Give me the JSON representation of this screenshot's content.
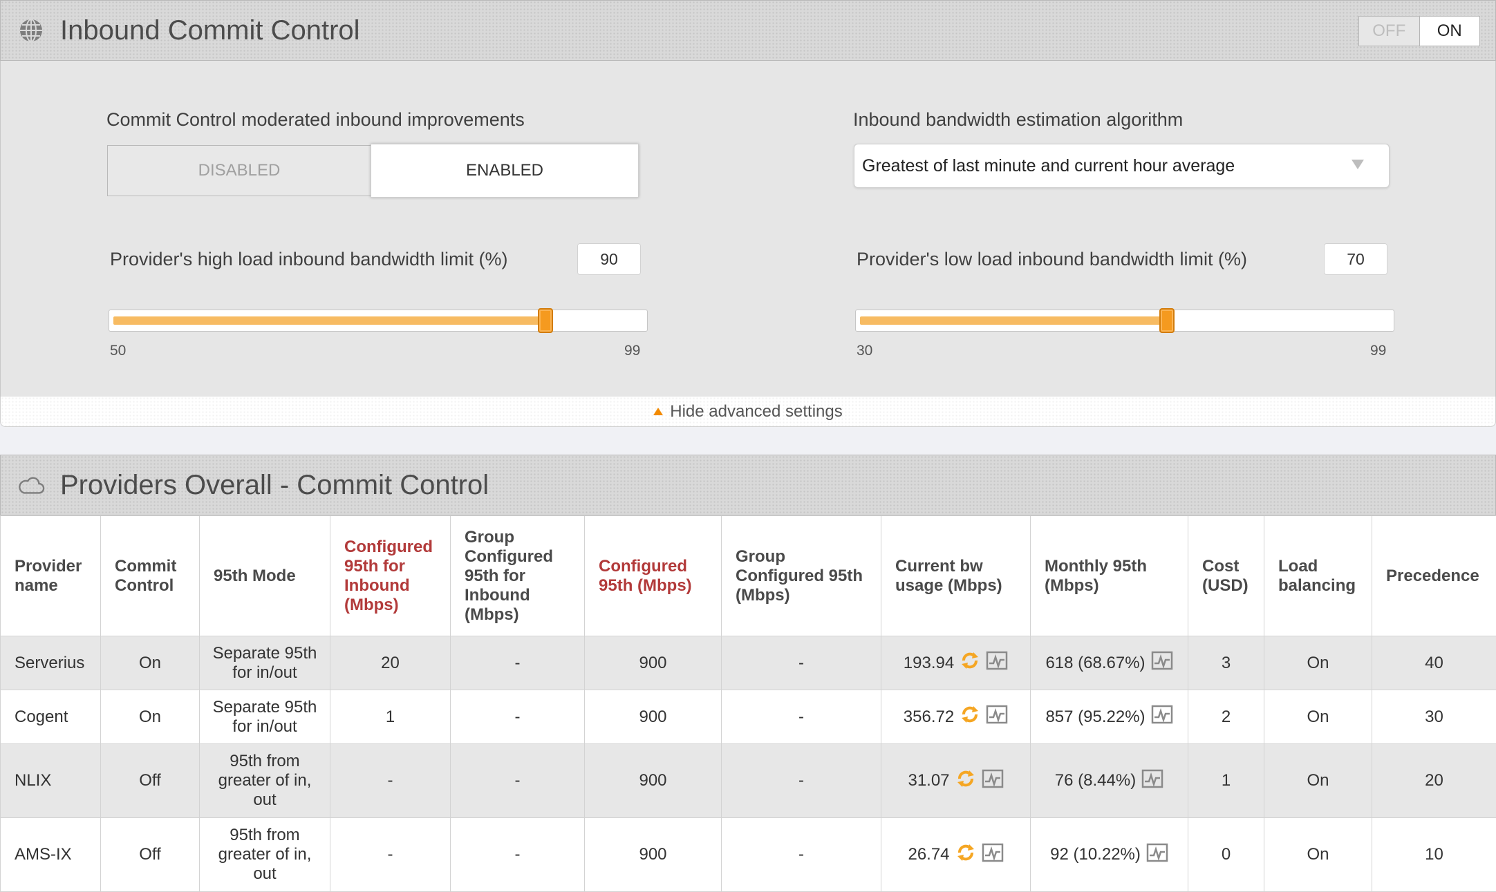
{
  "inbound": {
    "title": "Inbound Commit Control",
    "toggle": {
      "off_label": "OFF",
      "on_label": "ON",
      "state": "ON"
    },
    "moderated_label": "Commit Control moderated inbound improvements",
    "moderated": {
      "disabled_label": "DISABLED",
      "enabled_label": "ENABLED",
      "state": "ENABLED"
    },
    "algorithm_label": "Inbound bandwidth estimation algorithm",
    "algorithm_value": "Greatest of last minute and current hour average",
    "high_limit": {
      "label": "Provider's high load inbound bandwidth limit (%)",
      "value": "90",
      "min": "50",
      "max": "99",
      "level": 90
    },
    "low_limit": {
      "label": "Provider's low load inbound bandwidth limit (%)",
      "value": "70",
      "min": "30",
      "max": "99",
      "level": 70
    },
    "hide_advanced_label": "Hide advanced settings"
  },
  "providers": {
    "title": "Providers Overall - Commit Control",
    "columns": [
      "Provider name",
      "Commit Control",
      "95th Mode",
      "Configured 95th for Inbound (Mbps)",
      "Group Configured 95th for Inbound (Mbps)",
      "Configured 95th (Mbps)",
      "Group Configured 95th (Mbps)",
      "Current bw usage (Mbps)",
      "Monthly 95th (Mbps)",
      "Cost (USD)",
      "Load balancing",
      "Precedence"
    ],
    "rows": [
      {
        "name": "Serverius",
        "commit": "On",
        "mode": "Separate 95th for in/out",
        "cfg_in": "20",
        "grp_in": "-",
        "cfg": "900",
        "grp": "-",
        "current": "193.94",
        "monthly": "618 (68.67%)",
        "cost": "3",
        "lb": "On",
        "prec": "40"
      },
      {
        "name": "Cogent",
        "commit": "On",
        "mode": "Separate 95th for in/out",
        "cfg_in": "1",
        "grp_in": "-",
        "cfg": "900",
        "grp": "-",
        "current": "356.72",
        "monthly": "857 (95.22%)",
        "cost": "2",
        "lb": "On",
        "prec": "30"
      },
      {
        "name": "NLIX",
        "commit": "Off",
        "mode": "95th from greater of in, out",
        "cfg_in": "-",
        "grp_in": "-",
        "cfg": "900",
        "grp": "-",
        "current": "31.07",
        "monthly": "76 (8.44%)",
        "cost": "1",
        "lb": "On",
        "prec": "20"
      },
      {
        "name": "AMS-IX",
        "commit": "Off",
        "mode": "95th from greater of in, out",
        "cfg_in": "-",
        "grp_in": "-",
        "cfg": "900",
        "grp": "-",
        "current": "26.74",
        "monthly": "92 (10.22%)",
        "cost": "0",
        "lb": "On",
        "prec": "10"
      }
    ]
  },
  "colors": {
    "accent": "#f59a1f",
    "slider_fill": "#f7bb62",
    "header_red": "#b23a3a"
  },
  "icons": {
    "inbound_header": "globe-icon",
    "providers_header": "cloud-icon",
    "refresh": "refresh-icon",
    "chart": "chart-icon"
  }
}
